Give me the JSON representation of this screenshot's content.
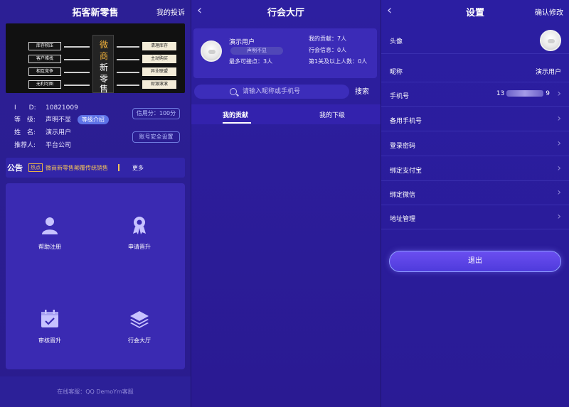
{
  "screen1": {
    "title": "拓客新零售",
    "right_link": "我的投诉",
    "banner": {
      "left_items": [
        "库存积压",
        "客户难找",
        "相互竞争",
        "无利可图"
      ],
      "center_chars": [
        "微",
        "商",
        "新",
        "零",
        "售"
      ],
      "right_items": [
        "清理库存",
        "主动购买",
        "异业联盟",
        "财源滚滚"
      ]
    },
    "profile": {
      "id_label": "I　　D:",
      "id_value": "10821009",
      "level_label": "等　级:",
      "level_value": "声明不显",
      "level_badge": "等级介绍",
      "name_label": "姓　名:",
      "name_value": "演示用户",
      "referrer_label": "推荐人:",
      "referrer_value": "平台公司",
      "credit_button": "信用分：100分",
      "security_button": "账号安全设置"
    },
    "notice": {
      "title": "公告",
      "hot_tag": "热点",
      "message": "微商新零售颠覆传统销售",
      "more": "更多"
    },
    "menu": [
      {
        "label": "帮助注册",
        "icon": "user-icon"
      },
      {
        "label": "申请晋升",
        "icon": "award-icon"
      },
      {
        "label": "审核晋升",
        "icon": "calendar-check-icon"
      },
      {
        "label": "行会大厅",
        "icon": "layers-icon"
      }
    ],
    "footer": "在线客服：QQ DemoYm客服"
  },
  "screen2": {
    "title": "行会大厅",
    "user": {
      "name": "演示用户",
      "tag": "声明不显",
      "max_nodes": "最多可接点：3人",
      "my_contribution": "我的贡献：7人",
      "guild_info": "行会信息：0人",
      "level1_plus": "第1关及以上人数：0人"
    },
    "search": {
      "placeholder": "请输入昵称或手机号",
      "button": "搜索"
    },
    "tabs": [
      "我的贡献",
      "我的下级"
    ]
  },
  "screen3": {
    "title": "设置",
    "right_link": "确认修改",
    "rows": {
      "avatar_label": "头像",
      "nickname_label": "昵称",
      "nickname_value": "演示用户",
      "phone_label": "手机号",
      "phone_prefix": "13",
      "phone_suffix": "9",
      "backup_phone_label": "备用手机号",
      "login_password_label": "登录密码",
      "alipay_label": "绑定支付宝",
      "wechat_label": "绑定微信",
      "address_label": "地址管理"
    },
    "logout": "退出"
  },
  "colors": {
    "background": "#2a1d8a",
    "card": "#3b2bb7",
    "accent_gold": "#f2c25a",
    "accent_blue": "#5e73e8"
  }
}
